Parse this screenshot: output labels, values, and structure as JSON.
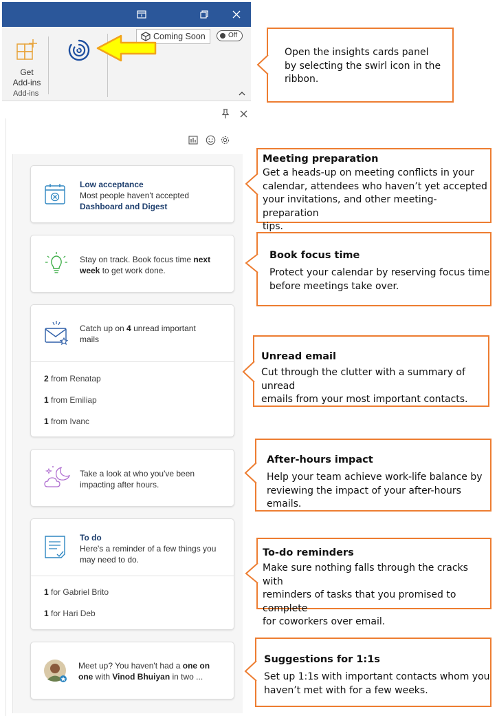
{
  "window": {
    "restore_icon": "window-restore-icon",
    "maximize_icon": "window-maximize-icon",
    "close_icon": "close-icon"
  },
  "ribbon": {
    "get_addins_line1": "Get",
    "get_addins_line2": "Add-ins",
    "group_label": "Add-ins",
    "coming_soon": "Coming Soon",
    "toggle": "Off"
  },
  "pane": {
    "cards": {
      "meeting": {
        "title": "Low acceptance",
        "line1": "Most people haven't accepted",
        "line2": "Dashboard and Digest"
      },
      "focus": {
        "pre": "Stay on track. Book focus time ",
        "kw": "next",
        "line2_kw": "week",
        "post": " to get work done."
      },
      "email": {
        "pre": "Catch up on ",
        "count": "4",
        "post": " unread important",
        "line2": "mails",
        "rows": [
          {
            "n": "2",
            "from": " from Renatap"
          },
          {
            "n": "1",
            "from": " from Emiliap"
          },
          {
            "n": "1",
            "from": " from Ivanc"
          }
        ]
      },
      "afterhours": {
        "line1": "Take a look at who you've been",
        "line2": "impacting after hours."
      },
      "todo": {
        "title": "To do",
        "line1": "Here's a reminder of a few things you",
        "line2": "may need to do.",
        "rows": [
          {
            "n": "1",
            "from": " for Gabriel Brito"
          },
          {
            "n": "1",
            "from": " for Hari Deb"
          }
        ]
      },
      "oneonone": {
        "pre": "Meet up? You haven't had a ",
        "kw1": " one on",
        "kw2": "one",
        "mid": " with ",
        "name": "Vinod Bhuiyan",
        "post": " in two ..."
      }
    }
  },
  "callouts": {
    "insights": {
      "line1": "Open the insights cards panel",
      "line2": "by selecting the swirl icon in the",
      "line3": "ribbon."
    },
    "meeting": {
      "title": "Meeting preparation",
      "l1": "Get a heads-up on meeting conflicts in your",
      "l2": "calendar, attendees who haven’t yet accepted",
      "l3": "your invitations, and other meeting-preparation",
      "l4": "tips."
    },
    "focus": {
      "title": "Book focus time",
      "l1": "Protect your calendar by reserving focus time",
      "l2": "before meetings take over."
    },
    "email": {
      "title": "Unread email",
      "l1": "Cut through the clutter with a summary of unread",
      "l2": "emails from your most important contacts."
    },
    "afterhours": {
      "title": "After-hours impact",
      "l1": "Help your team achieve work-life balance by",
      "l2": "reviewing the impact of your after-hours emails."
    },
    "todo": {
      "title": "To-do reminders",
      "l1": "Make sure nothing falls through the cracks with",
      "l2": "reminders of tasks that you promised to complete",
      "l3": "for coworkers over email."
    },
    "oneonone": {
      "title": "Suggestions for 1:1s",
      "l1": "Set up 1:1s with important contacts whom you",
      "l2": "haven’t met with for a few weeks."
    }
  },
  "colors": {
    "titlebar": "#2b579a",
    "accent_orange": "#ed7d31",
    "arrow_yellow": "#ffff00",
    "swirl_blue": "#1e4fa0"
  }
}
